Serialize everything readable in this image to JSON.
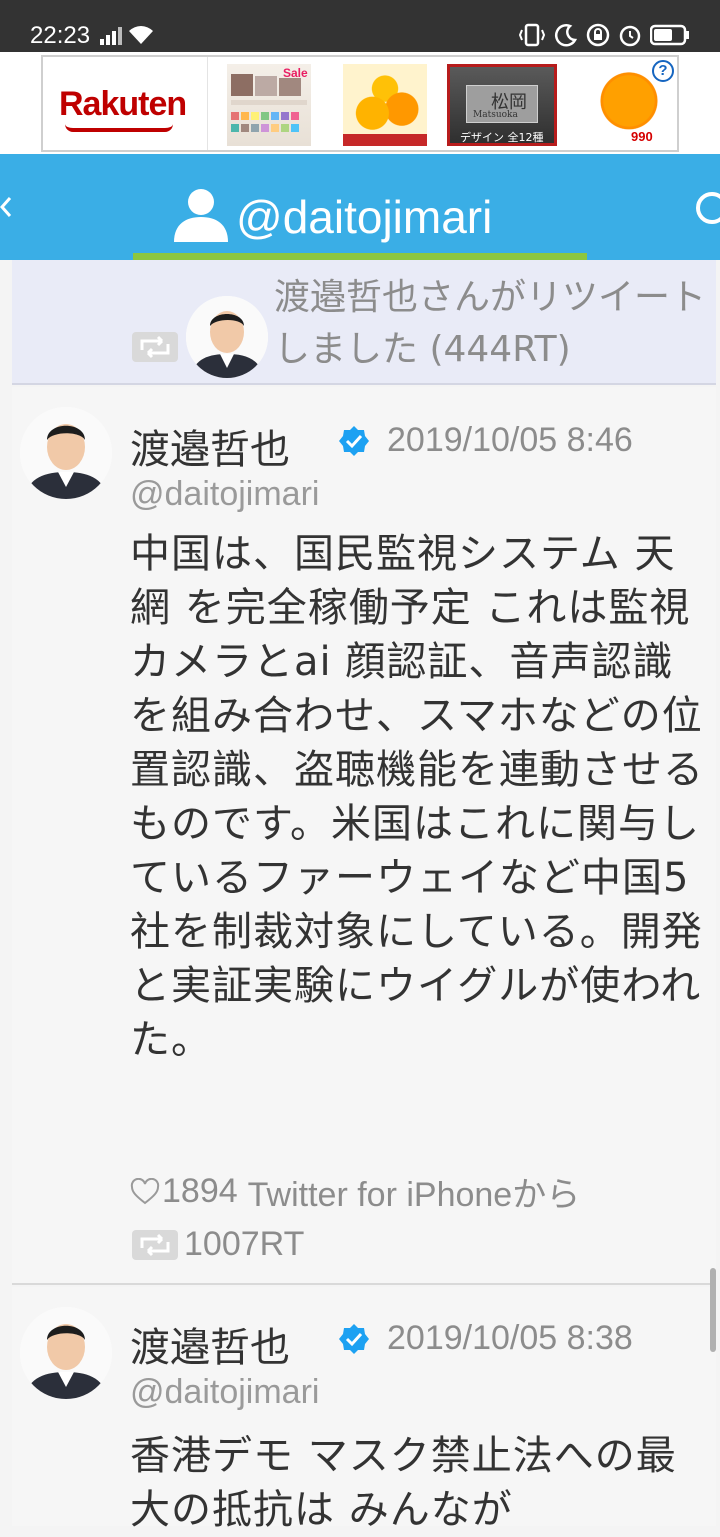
{
  "status_bar": {
    "time": "22:23"
  },
  "ad": {
    "brand": "Rakuten",
    "thumb1_tag": "Sale",
    "thumb3_name": "松岡",
    "thumb3_sub": "Matsuoka",
    "thumb3_caption": "デザイン 全12種",
    "thumb4_price": "990",
    "help": "?"
  },
  "header": {
    "handle": "@daitojimari"
  },
  "retweet_notice": {
    "text": "渡邉哲也さんがリツイートしました (444RT)"
  },
  "tweets": [
    {
      "name": "渡邉哲也",
      "date": "2019/10/05 8:46",
      "handle": "@daitojimari",
      "body": "中国は、国民監視システム 天網 を完全稼働予定 これは監視カメラとai 顔認証、音声認識を組み合わせ、スマホなどの位置認識、盗聴機能を連動させるものです。米国はこれに関与しているファーウェイなど中国5社を制裁対象にしている。開発と実証実験にウイグルが使われた。",
      "likes": "1894",
      "source": "Twitter for iPhoneから",
      "retweets": "1007RT"
    },
    {
      "name": "渡邉哲也",
      "date": "2019/10/05 8:38",
      "handle": "@daitojimari",
      "body": "香港デモ マスク禁止法への最大の抵抗は みんなが"
    }
  ],
  "colors": {
    "header_bg": "#3aaee6",
    "header_underline": "#8dc63f",
    "rakuten_red": "#bf0000",
    "verified_blue": "#1da1f2"
  }
}
